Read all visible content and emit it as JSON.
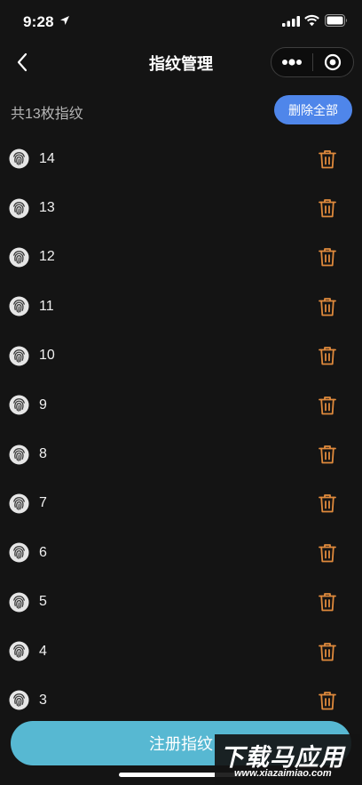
{
  "status_bar": {
    "time": "9:28"
  },
  "nav": {
    "title": "指纹管理"
  },
  "summary": {
    "count_text": "共13枚指纹",
    "delete_all_label": "删除全部"
  },
  "fingerprints": [
    "14",
    "13",
    "12",
    "11",
    "10",
    "9",
    "8",
    "7",
    "6",
    "5",
    "4",
    "3"
  ],
  "register_button_label": "注册指纹",
  "watermark": {
    "main": "下载马应用",
    "sub": "www.xiazaimiao.com"
  },
  "colors": {
    "background": "#141414",
    "accent_blue": "#4f86ea",
    "register_button": "#57b8d2",
    "delete_icon": "#e08a3c"
  }
}
